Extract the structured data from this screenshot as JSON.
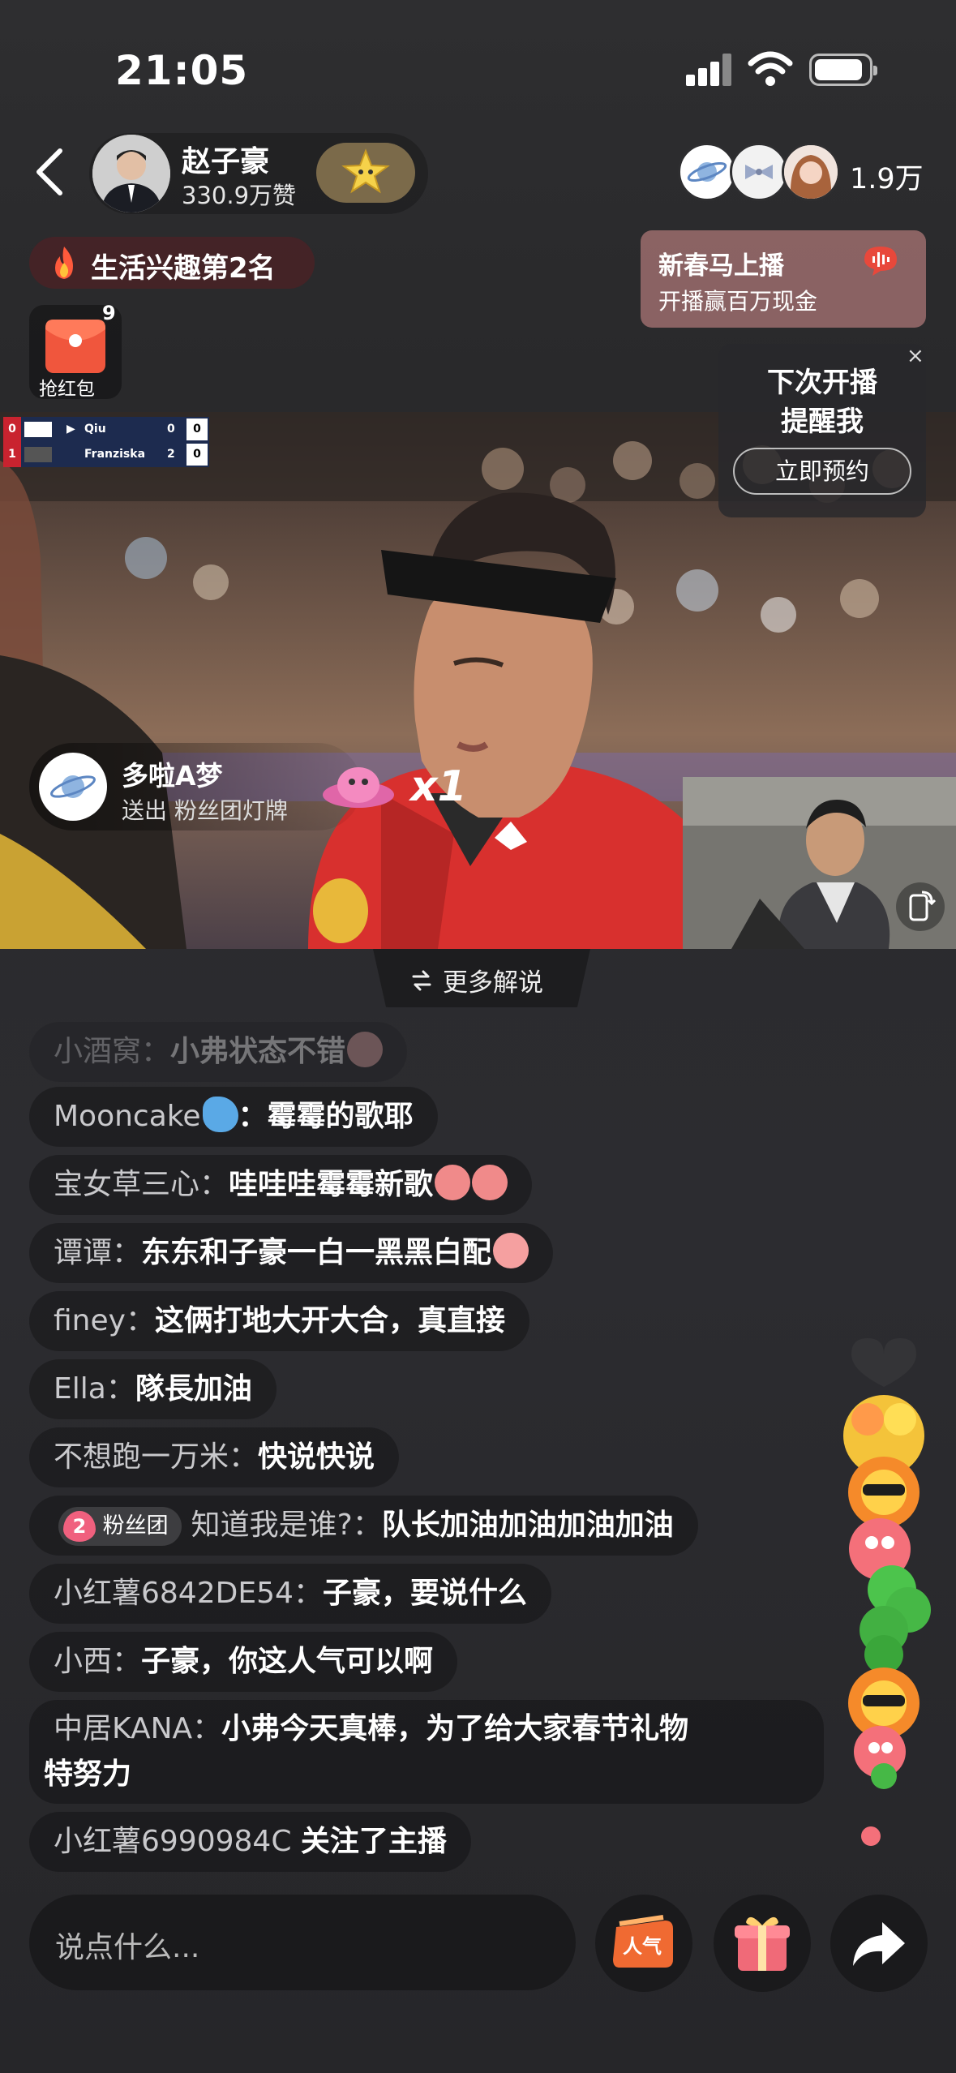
{
  "status_bar": {
    "time": "21:05"
  },
  "header": {
    "host_name": "赵子豪",
    "host_likes": "330.9万赞",
    "viewer_count": "1.9万"
  },
  "rank": {
    "label": "生活兴趣第2名"
  },
  "promo": {
    "title": "新春马上播",
    "subtitle": "开播赢百万现金"
  },
  "red_packet": {
    "count": "9",
    "label": "抢红包"
  },
  "reminder": {
    "line1": "下次开播",
    "line2": "提醒我",
    "button": "立即预约",
    "close": "×"
  },
  "scoreboard": {
    "rows": [
      {
        "set": "0",
        "name": "Qiu",
        "games": "0",
        "points": "0"
      },
      {
        "set": "1",
        "name": "Franziska",
        "games": "2",
        "points": "0"
      }
    ]
  },
  "gift": {
    "user": "多啦A梦",
    "description": "送出 粉丝团灯牌",
    "count": "x1"
  },
  "more_commentary": {
    "label": "更多解说"
  },
  "comments": [
    {
      "user": "小酒窝：",
      "text": "小弗状态不错"
    },
    {
      "user": "Mooncake",
      "text": "：霉霉的歌耶"
    },
    {
      "user": "宝女草三心：",
      "text": "哇哇哇霉霉新歌"
    },
    {
      "user": "谭谭：",
      "text": "东东和子豪一白一黑黑白配"
    },
    {
      "user": "finey：",
      "text": "这俩打地大开大合，真直接"
    },
    {
      "user": "Ella：",
      "text": "隊長加油"
    },
    {
      "user": "不想跑一万米：",
      "text": "快说快说"
    },
    {
      "badge_level": "2",
      "badge_label": "粉丝团",
      "user": "知道我是谁?：",
      "text": "队长加油加油加油加油"
    },
    {
      "user": "小红薯6842DE54：",
      "text": "子豪，要说什么"
    },
    {
      "user": "小西：",
      "text": "子豪，你这人气可以啊"
    },
    {
      "user": "中居KANA：",
      "text": "小弗今天真棒，为了给大家春节礼物",
      "text2": "特努力"
    },
    {
      "user": "小红薯6990984C",
      "text": "关注了主播"
    }
  ],
  "bottom_bar": {
    "input_placeholder": "说点什么..."
  },
  "colors": {
    "accent_red": "#e8483b",
    "gold": "#7b6a4a",
    "jersey_red": "#d8302e"
  }
}
